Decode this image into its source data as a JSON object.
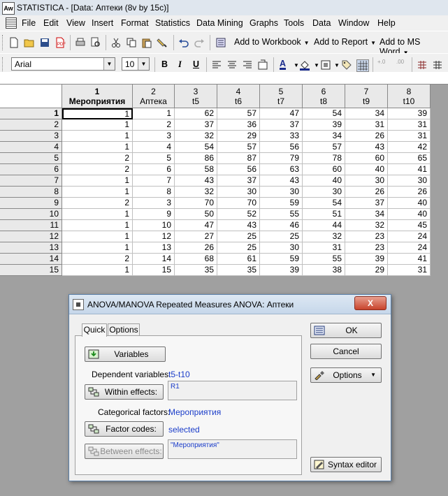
{
  "window": {
    "title": "STATISTICA - [Data: Аптеки (8v by 15c)]",
    "app_icon": "Aw"
  },
  "menu": [
    "File",
    "Edit",
    "View",
    "Insert",
    "Format",
    "Statistics",
    "Data Mining",
    "Graphs",
    "Tools",
    "Data",
    "Window",
    "Help"
  ],
  "toolbar1": {
    "add_to_workbook": "Add to Workbook",
    "add_to_report": "Add to Report",
    "add_to_ms_word": "Add to MS Word"
  },
  "toolbar2": {
    "font": "Arial",
    "size": "10",
    "bold": "B",
    "italic": "I",
    "underline": "U",
    "font_color_letter": "A",
    "dec_more": "+.0",
    "dec_less": ".00"
  },
  "spreadsheet": {
    "columns": [
      {
        "num": "1",
        "name": "Мероприятия"
      },
      {
        "num": "2",
        "name": "Аптека"
      },
      {
        "num": "3",
        "name": "t5"
      },
      {
        "num": "4",
        "name": "t6"
      },
      {
        "num": "5",
        "name": "t7"
      },
      {
        "num": "6",
        "name": "t8"
      },
      {
        "num": "7",
        "name": "t9"
      },
      {
        "num": "8",
        "name": "t10"
      }
    ],
    "rows": [
      {
        "n": "1",
        "v": [
          "1",
          "1",
          "62",
          "57",
          "47",
          "54",
          "34",
          "39"
        ]
      },
      {
        "n": "2",
        "v": [
          "1",
          "2",
          "37",
          "36",
          "37",
          "39",
          "31",
          "31"
        ]
      },
      {
        "n": "3",
        "v": [
          "1",
          "3",
          "32",
          "29",
          "33",
          "34",
          "26",
          "31"
        ]
      },
      {
        "n": "4",
        "v": [
          "1",
          "4",
          "54",
          "57",
          "56",
          "57",
          "43",
          "42"
        ]
      },
      {
        "n": "5",
        "v": [
          "2",
          "5",
          "86",
          "87",
          "79",
          "78",
          "60",
          "65"
        ]
      },
      {
        "n": "6",
        "v": [
          "2",
          "6",
          "58",
          "56",
          "63",
          "60",
          "40",
          "41"
        ]
      },
      {
        "n": "7",
        "v": [
          "1",
          "7",
          "43",
          "37",
          "43",
          "40",
          "30",
          "30"
        ]
      },
      {
        "n": "8",
        "v": [
          "1",
          "8",
          "32",
          "30",
          "30",
          "30",
          "26",
          "26"
        ]
      },
      {
        "n": "9",
        "v": [
          "2",
          "3",
          "70",
          "70",
          "59",
          "54",
          "37",
          "40"
        ]
      },
      {
        "n": "10",
        "v": [
          "1",
          "9",
          "50",
          "52",
          "55",
          "51",
          "34",
          "40"
        ]
      },
      {
        "n": "11",
        "v": [
          "1",
          "10",
          "47",
          "43",
          "46",
          "44",
          "32",
          "45"
        ]
      },
      {
        "n": "12",
        "v": [
          "1",
          "12",
          "27",
          "25",
          "25",
          "32",
          "23",
          "24"
        ]
      },
      {
        "n": "13",
        "v": [
          "1",
          "13",
          "26",
          "25",
          "30",
          "31",
          "23",
          "24"
        ]
      },
      {
        "n": "14",
        "v": [
          "2",
          "14",
          "68",
          "61",
          "59",
          "55",
          "39",
          "41"
        ]
      },
      {
        "n": "15",
        "v": [
          "1",
          "15",
          "35",
          "35",
          "39",
          "38",
          "29",
          "31"
        ]
      }
    ]
  },
  "dialog": {
    "title": "ANOVA/MANOVA Repeated Measures ANOVA: Аптеки",
    "close": "X",
    "tabs": [
      "Quick",
      "Options"
    ],
    "variables_button": "Variables",
    "dependent_label": "Dependent variables:",
    "dependent_value": "t5-t10",
    "within_button": "Within effects:",
    "within_value": "R1",
    "categorical_label": "Categorical factors:",
    "categorical_value": "Мероприятия",
    "factor_codes_button": "Factor codes:",
    "factor_codes_value": "selected",
    "between_button": "Between effects:",
    "between_value": "\"Мероприятия\"",
    "ok": "OK",
    "cancel": "Cancel",
    "options": "Options",
    "syntax_editor": "Syntax editor"
  }
}
